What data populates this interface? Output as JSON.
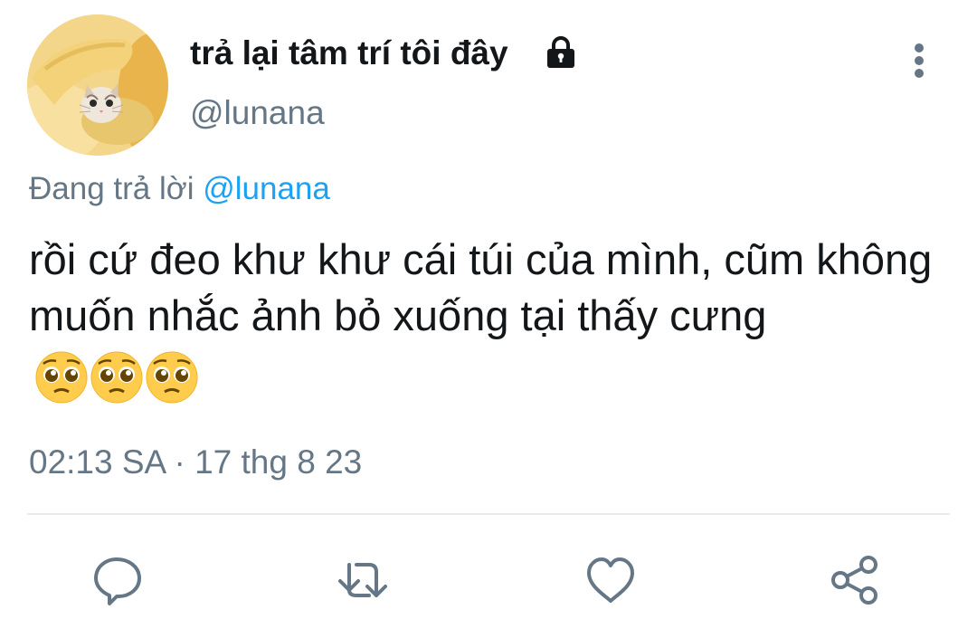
{
  "tweet": {
    "display_name": "trả lại tâm trí tôi đây",
    "handle": "@lunana",
    "reply_prefix": "Đang trả lời",
    "reply_mention": "@lunana",
    "text": "rồi cứ đeo khư khư cái túi của mình, cũm không muốn nhắc ảnh bỏ xuống tại thấy cưng",
    "emojis": [
      "pleading-face",
      "pleading-face",
      "pleading-face"
    ],
    "time": "02:13 SA",
    "separator": "·",
    "date": "17 thg 8 23"
  },
  "icons": {
    "lock": "lock-icon",
    "more": "vertical-ellipsis-icon",
    "reply": "reply-icon",
    "retweet": "retweet-icon",
    "like": "heart-icon",
    "share": "share-icon"
  },
  "colors": {
    "name": "#14171a",
    "secondary_text": "#657786",
    "link": "#1da1f2",
    "icon": "#657786",
    "divider": "#e6ecf0"
  }
}
